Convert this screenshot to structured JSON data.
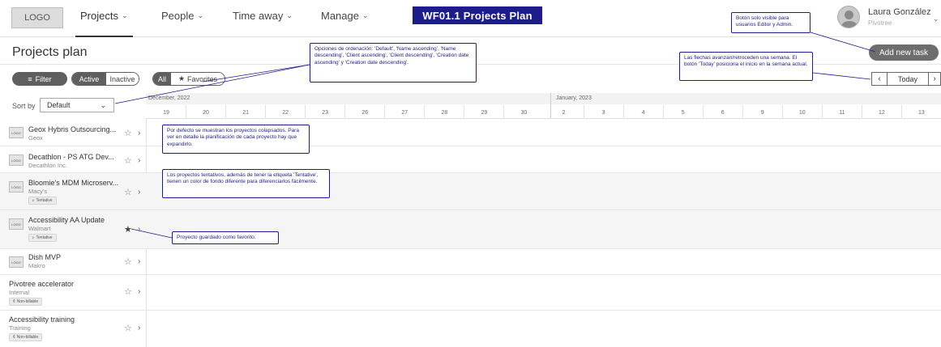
{
  "nav": {
    "logo": "LOGO",
    "items": [
      {
        "label": "Projects",
        "active": true
      },
      {
        "label": "People"
      },
      {
        "label": "Time away"
      },
      {
        "label": "Manage"
      }
    ],
    "wireframe_badge": "WF01.1 Projects Plan",
    "user": {
      "name": "Laura González",
      "org": "Pivotree"
    }
  },
  "page": {
    "title": "Projects plan",
    "add_task_label": "Add new task",
    "filter_label": "Filter",
    "status_toggle": {
      "active": "Active",
      "inactive": "Inactive"
    },
    "scope_toggle": {
      "all": "All",
      "favorites": "Favorites"
    },
    "today_label": "Today",
    "sort_label": "Sort by",
    "sort_value": "Default"
  },
  "timeline": {
    "months": [
      {
        "label": "December, 2022"
      },
      {
        "label": "January, 2023"
      }
    ],
    "days": [
      "19",
      "20",
      "21",
      "22",
      "23",
      "26",
      "27",
      "28",
      "29",
      "30",
      "2",
      "3",
      "4",
      "5",
      "6",
      "9",
      "10",
      "11",
      "12",
      "13"
    ]
  },
  "projects": [
    {
      "name": "Geox Hybris Outsourcing...",
      "client": "Geox",
      "logo": "LOGO",
      "favorite": false
    },
    {
      "name": "Decathlon - PS ATG Dev...",
      "client": "Decathlon Inc.",
      "logo": "LOGO",
      "favorite": false
    },
    {
      "name": "Bloomie's MDM Microserv...",
      "client": "Macy's",
      "logo": "LOGO",
      "tag": "Tentative",
      "favorite": false
    },
    {
      "name": "Accessibility AA Update",
      "client": "Walmart",
      "logo": "LOGO",
      "tag": "Tentative",
      "favorite": true
    },
    {
      "name": "Dish MVP",
      "client": "Makro",
      "logo": "LOGO",
      "favorite": false
    },
    {
      "name": "Pivotree accelerator",
      "client": "Internal",
      "tag": "Non-billable",
      "favorite": false
    },
    {
      "name": "Accessibility training",
      "client": "Training",
      "tag": "Non-billable",
      "favorite": false
    }
  ],
  "annotations": {
    "sort_note": "Opciones de ordenación: 'Default', 'Name ascending', 'Name descending', 'Client ascending', 'Client descending', 'Creation date ascending' y 'Creation date descending'.",
    "addtask_note": "Botón solo visible para usuarios Editor y Admin.",
    "arrows_note": "Las flechas avanzan/retroceden una semana. El botón 'Today' posiciona el inicio en la semana actual.",
    "collapsed_note": "Por defecto se muestran los proyectos colapsados. Para ver en detalle la planificación de cada proyecto hay que expandirlo.",
    "tentative_note": "Los proyectos tentativos, además de tener la etiqueta 'Tentative', tienen un color de fondo diferente para diferenciarlos fácilmente.",
    "favorite_note": "Proyecto guardado como favorito."
  },
  "colors": {
    "accent": "#1c1c8c",
    "button_dark": "#5f5f5f",
    "tentative_bg": "#f5f5f5"
  }
}
